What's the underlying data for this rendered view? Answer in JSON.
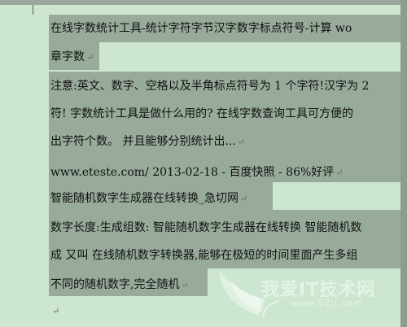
{
  "document": {
    "lines": [
      {
        "text": "在线字数统计工具-统计字符字节汉字数字标点符号-计算 wo",
        "mark": ""
      },
      {
        "text": "章字数",
        "mark": "↵"
      },
      {
        "text": "注意:英文、数字、空格以及半角标点符号为 1 个字符!汉字为 2",
        "mark": ""
      },
      {
        "text": "符! 字数统计工具是做什么用的? 在线字数查询工具可方便的",
        "mark": ""
      },
      {
        "text": "出字符个数。 并且能够分别统计出...",
        "mark": "↵"
      },
      {
        "text": "www.eteste.com/ 2013-02-18 - 百度快照 - 86%好评",
        "mark": "↵"
      },
      {
        "text": "智能随机数字生成器在线转换_急切网",
        "mark": "↵"
      },
      {
        "text": "数字长度:生成组数: 智能随机数字生成器在线转换 智能随机数",
        "mark": ""
      },
      {
        "text": "成 又叫 在线随机数字转换器,能够在极短的时间里面产生多组",
        "mark": ""
      },
      {
        "text": "不同的随机数字,完全随机",
        "mark": "↵"
      },
      {
        "text": "",
        "mark": "↵"
      }
    ]
  },
  "watermark": {
    "text": "我爱IT技术网",
    "url": "www.52ij.com"
  }
}
